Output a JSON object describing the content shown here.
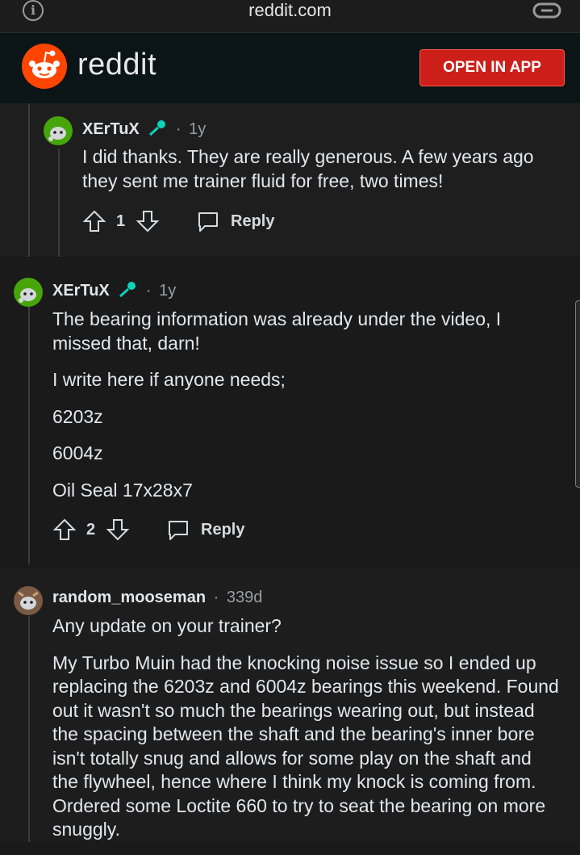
{
  "browser": {
    "url": "reddit.com"
  },
  "header": {
    "brand": "reddit",
    "open_app_label": "OPEN IN APP"
  },
  "comments": [
    {
      "username": "XErTuX",
      "separator": "·",
      "age": "1y",
      "paragraphs": [
        "I did thanks. They are really generous. A few years ago they sent me trainer fluid for free, two times!"
      ],
      "score": "1",
      "reply_label": "Reply"
    },
    {
      "username": "XErTuX",
      "separator": "·",
      "age": "1y",
      "paragraphs": [
        "The bearing information was already under the video, I missed that, darn!",
        "I write here if anyone needs;",
        "6203z",
        "6004z",
        "Oil Seal 17x28x7"
      ],
      "score": "2",
      "reply_label": "Reply"
    },
    {
      "username": "random_mooseman",
      "separator": "·",
      "age": "339d",
      "paragraphs": [
        "Any update on your trainer?",
        "My Turbo Muin had the knocking noise issue so I ended up replacing the 6203z and 6004z bearings this weekend. Found out it wasn't so much the bearings wearing out, but instead the spacing between the shaft and the bearing's inner bore isn't totally snug and allows for some play on the shaft and the flywheel, hence where I think my knock is coming from. Ordered some Loctite 660 to try to seat the bearing on more snuggly."
      ]
    }
  ],
  "colors": {
    "accent": "#ff4500",
    "button": "#cc1f1a",
    "background": "#1a1a1b",
    "mic": "#0dd3bb"
  },
  "icons": [
    "info-icon",
    "link-icon",
    "reddit-logo",
    "microphone-icon",
    "upvote-icon",
    "downvote-icon",
    "comment-icon"
  ]
}
